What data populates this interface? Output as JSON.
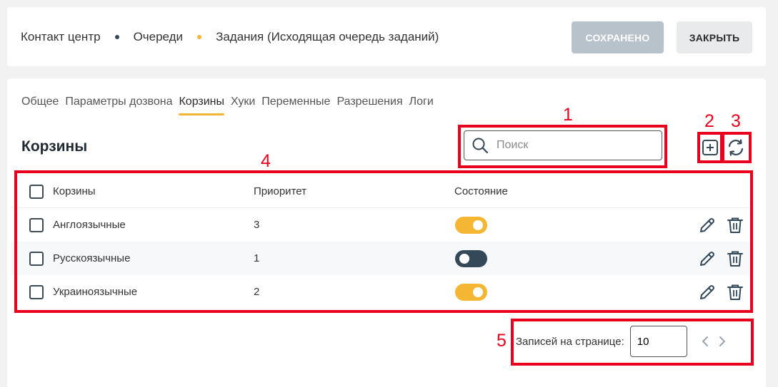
{
  "header": {
    "breadcrumbs": [
      "Контакт центр",
      "Очереди",
      "Задания (Исходящая очередь заданий)"
    ],
    "sep_colors": [
      "#33495a",
      "#f5b733"
    ],
    "saved_button": "СОХРАНЕНО",
    "close_button": "ЗАКРЫТЬ"
  },
  "tabs": [
    {
      "label": "Общее",
      "active": false
    },
    {
      "label": "Параметры дозвона",
      "active": false
    },
    {
      "label": "Корзины",
      "active": true
    },
    {
      "label": "Хуки",
      "active": false
    },
    {
      "label": "Переменные",
      "active": false
    },
    {
      "label": "Разрешения",
      "active": false
    },
    {
      "label": "Логи",
      "active": false
    }
  ],
  "section": {
    "title": "Корзины",
    "search_placeholder": "Поиск",
    "add_icon": "plus-square-icon",
    "refresh_icon": "refresh-icon"
  },
  "table": {
    "columns": [
      "Корзины",
      "Приоритет",
      "Состояние"
    ],
    "rows": [
      {
        "name": "Англоязычные",
        "priority": "3",
        "enabled": true
      },
      {
        "name": "Русскоязычные",
        "priority": "1",
        "enabled": false
      },
      {
        "name": "Украиноязычные",
        "priority": "2",
        "enabled": true
      }
    ]
  },
  "pagination": {
    "label": "Записей на странице:",
    "per_page": "10"
  },
  "annotations": [
    "1",
    "2",
    "3",
    "4",
    "5"
  ],
  "colors": {
    "accent": "#f5b733",
    "dark": "#33495a",
    "annotation": "#e8001c"
  }
}
